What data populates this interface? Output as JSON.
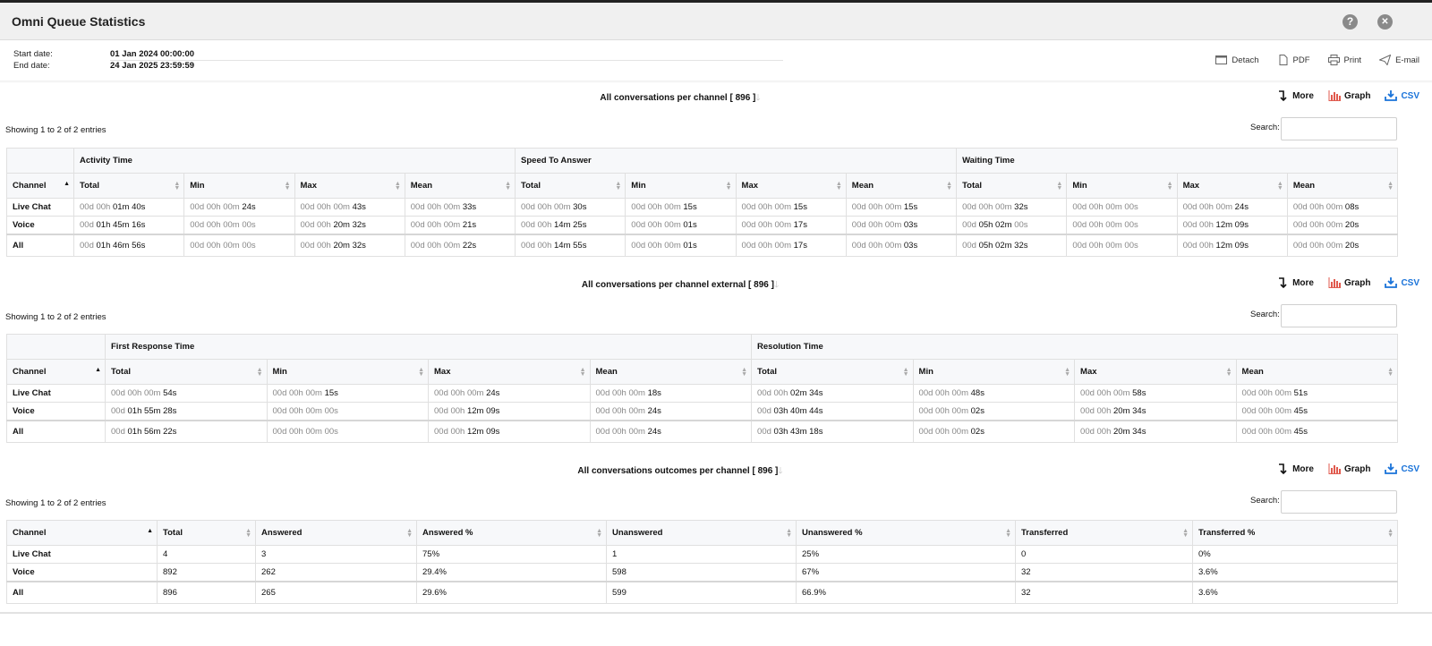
{
  "window": {
    "title": "Omni Queue Statistics",
    "help_glyph": "?",
    "close_glyph": "✕"
  },
  "dates": {
    "start_label": "Start date:",
    "start_value": "01 Jan 2024 00:00:00",
    "end_label": "End date:",
    "end_value": "24 Jan 2025 23:59:59"
  },
  "actions": [
    "Detach",
    "PDF",
    "Print",
    "E-mail"
  ],
  "tools": {
    "more": "More",
    "graph": "Graph",
    "csv": "CSV"
  },
  "colors": {
    "graph_icon": "#e05a4e",
    "csv": "#1a73d9"
  },
  "showing": "Showing 1 to 2 of 2 entries",
  "search_label": "Search:",
  "section1": {
    "title": "All conversations per channel [ 896 ]",
    "groups": [
      "Activity Time",
      "Speed To Answer",
      "Waiting Time"
    ],
    "headers": [
      "Channel",
      "Total",
      "Min",
      "Max",
      "Mean",
      "Total",
      "Min",
      "Max",
      "Mean",
      "Total",
      "Min",
      "Max",
      "Mean"
    ],
    "rows": [
      [
        "Live Chat",
        "00d 00h ",
        "01m 40s",
        "00d 00h 00m ",
        "24s",
        "00d 00h 00m ",
        "43s",
        "00d 00h 00m ",
        "33s",
        "00d 00h 00m ",
        "30s",
        "00d 00h 00m ",
        "15s",
        "00d 00h 00m ",
        "15s",
        "00d 00h 00m ",
        "15s",
        "00d 00h 00m ",
        "32s",
        "00d 00h 00m 00s",
        "",
        "00d 00h 00m ",
        "24s",
        "00d 00h 00m ",
        "08s"
      ],
      [
        "Voice",
        "00d ",
        "01h 45m 16s",
        "00d 00h 00m 00s",
        "",
        "00d 00h ",
        "20m 32s",
        "00d 00h 00m ",
        "21s",
        "00d 00h ",
        "14m 25s",
        "00d 00h 00m ",
        "01s",
        "00d 00h 00m ",
        "17s",
        "00d 00h 00m ",
        "03s",
        "00d ",
        "05h 02m ",
        "00d 00h 00m 00s",
        "",
        "00d 00h ",
        "12m 09s",
        "00d 00h 00m ",
        "20s"
      ],
      [
        "All",
        "00d ",
        "01h 46m 56s",
        "00d 00h 00m 00s",
        "",
        "00d 00h ",
        "20m 32s",
        "00d 00h 00m ",
        "22s",
        "00d 00h ",
        "14m 55s",
        "00d 00h 00m ",
        "01s",
        "00d 00h 00m ",
        "17s",
        "00d 00h 00m ",
        "03s",
        "00d ",
        "05h 02m 32s",
        "00d 00h 00m 00s",
        "",
        "00d 00h ",
        "12m 09s",
        "00d 00h 00m ",
        "20s"
      ]
    ],
    "voice_wait_tail": "00s"
  },
  "section2": {
    "title": "All conversations per channel external [ 896 ]",
    "groups": [
      "First Response Time",
      "Resolution Time"
    ],
    "headers": [
      "Channel",
      "Total",
      "Min",
      "Max",
      "Mean",
      "Total",
      "Min",
      "Max",
      "Mean"
    ],
    "rows": [
      [
        "Live Chat",
        "00d 00h 00m ",
        "54s",
        "00d 00h 00m ",
        "15s",
        "00d 00h 00m ",
        "24s",
        "00d 00h 00m ",
        "18s",
        "00d 00h ",
        "02m 34s",
        "00d 00h 00m ",
        "48s",
        "00d 00h 00m ",
        "58s",
        "00d 00h 00m ",
        "51s"
      ],
      [
        "Voice",
        "00d ",
        "01h 55m 28s",
        "00d 00h 00m 00s",
        "",
        "00d 00h ",
        "12m 09s",
        "00d 00h 00m ",
        "24s",
        "00d ",
        "03h 40m 44s",
        "00d 00h 00m ",
        "02s",
        "00d 00h ",
        "20m 34s",
        "00d 00h 00m ",
        "45s"
      ],
      [
        "All",
        "00d ",
        "01h 56m 22s",
        "00d 00h 00m 00s",
        "",
        "00d 00h ",
        "12m 09s",
        "00d 00h 00m ",
        "24s",
        "00d ",
        "03h 43m 18s",
        "00d 00h 00m ",
        "02s",
        "00d 00h ",
        "20m 34s",
        "00d 00h 00m ",
        "45s"
      ]
    ]
  },
  "section3": {
    "title": "All conversations outcomes per channel [ 896 ]",
    "headers": [
      "Channel",
      "Total",
      "Answered",
      "Answered %",
      "Unanswered",
      "Unanswered %",
      "Transferred",
      "Transferred %"
    ],
    "rows": [
      [
        "Live Chat",
        "4",
        "3",
        "75%",
        "1",
        "25%",
        "0",
        "0%"
      ],
      [
        "Voice",
        "892",
        "262",
        "29.4%",
        "598",
        "67%",
        "32",
        "3.6%"
      ],
      [
        "All",
        "896",
        "265",
        "29.6%",
        "599",
        "66.9%",
        "32",
        "3.6%"
      ]
    ]
  }
}
